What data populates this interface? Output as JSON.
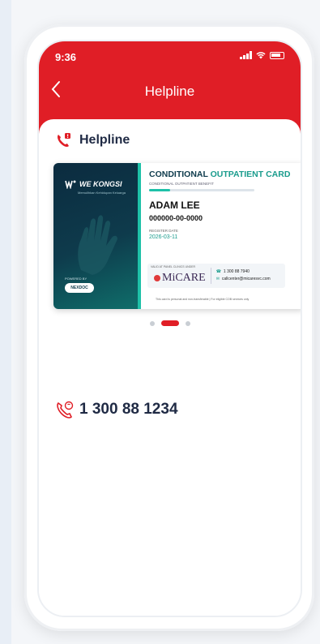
{
  "status_bar": {
    "time": "9:36"
  },
  "header": {
    "title": "Helpline"
  },
  "section": {
    "label": "Helpline"
  },
  "card": {
    "brand": "WE KONGSI",
    "brand_tagline": "Memulihkan Kehidupan Keluarga",
    "powered_by": "POWERED BY",
    "powered_logo": "NEXDOC",
    "title_part1": "CONDITIONAL ",
    "title_part2": "OUTPATIENT CARD",
    "subtitle": "CONDITIONAL OUTPATIENT BENEFIT",
    "holder_name": "ADAM LEE",
    "holder_id": "000000-00-0000",
    "register_label": "REGISTER DATE",
    "register_date": "2026-03-11",
    "valid_label": "VALID AT PANEL CLINICS UNDER",
    "partner_logo": "MiCARE",
    "partner_phone": "1 300 88 7940",
    "partner_email": "callcenter@micaresvc.com",
    "footer_note": "This card is personal and non-transferable  |  For eligible COB services only"
  },
  "carousel": {
    "total": 3,
    "active_index": 1
  },
  "helpline_number": "1 300 88 1234",
  "colors": {
    "brand_red": "#e01e26",
    "teal": "#1ec1a8",
    "navy": "#1f2a44"
  }
}
